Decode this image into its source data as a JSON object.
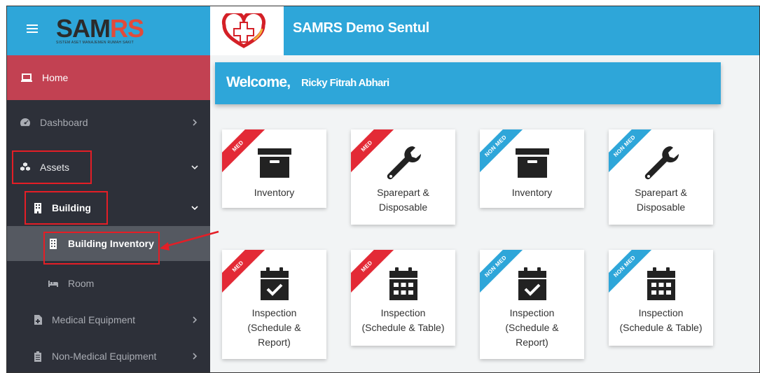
{
  "brand": {
    "logo_main": "SAM",
    "logo_accent": "RS",
    "logo_sub": "SISTEM ASET MANAJEMEN RUMAH SAKIT",
    "app_title": "SAMRS Demo Sentul"
  },
  "sidebar": {
    "home": "Home",
    "dashboard": "Dashboard",
    "assets": "Assets",
    "building": "Building",
    "building_inventory": "Building Inventory",
    "room": "Room",
    "medical_equipment": "Medical Equipment",
    "non_medical_equipment": "Non-Medical Equipment"
  },
  "welcome": {
    "greeting": "Welcome,",
    "user_name": "Ricky Fitrah Abhari"
  },
  "cards": [
    {
      "ribbon": "MED",
      "lines": [
        "Inventory"
      ],
      "icon": "archive-box-icon"
    },
    {
      "ribbon": "MED",
      "lines": [
        "Sparepart &",
        "Disposable"
      ],
      "icon": "wrench-icon"
    },
    {
      "ribbon": "NON MED",
      "lines": [
        "Inventory"
      ],
      "icon": "archive-box-icon"
    },
    {
      "ribbon": "NON MED",
      "lines": [
        "Sparepart &",
        "Disposable"
      ],
      "icon": "wrench-icon"
    },
    {
      "ribbon": "MED",
      "lines": [
        "Inspection",
        "(Schedule &",
        "Report)"
      ],
      "icon": "calendar-check-icon"
    },
    {
      "ribbon": "MED",
      "lines": [
        "Inspection",
        "(Schedule & Table)"
      ],
      "icon": "calendar-grid-icon"
    },
    {
      "ribbon": "NON MED",
      "lines": [
        "Inspection",
        "(Schedule &",
        "Report)"
      ],
      "icon": "calendar-check-icon"
    },
    {
      "ribbon": "NON MED",
      "lines": [
        "Inspection",
        "(Schedule & Table)"
      ],
      "icon": "calendar-grid-icon"
    }
  ],
  "colors": {
    "topbar": "#2ea6d9",
    "sidebar": "#2d3039",
    "home_active": "#c24152",
    "ribbon_med": "#e32a36",
    "ribbon_nonmed": "#2ea6d9",
    "highlight": "#e41e26"
  }
}
